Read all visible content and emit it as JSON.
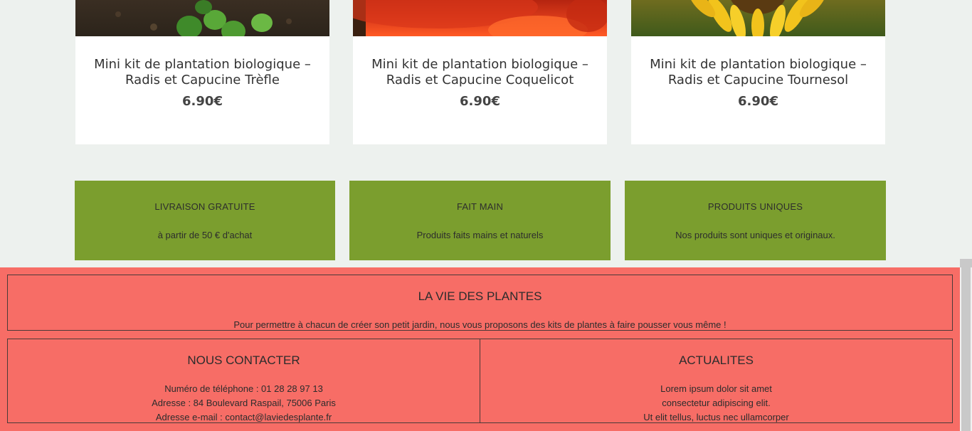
{
  "products": [
    {
      "name": "Mini kit de plantation biologique – Radis et Capucine Trèfle",
      "price": "6.90€",
      "image": "clover-seedling-photo"
    },
    {
      "name": "Mini kit de plantation biologique – Radis et Capucine Coquelicot",
      "price": "6.90€",
      "image": "poppy-flower-photo"
    },
    {
      "name": "Mini kit de plantation biologique – Radis et Capucine Tournesol",
      "price": "6.90€",
      "image": "sunflower-photo"
    }
  ],
  "features": [
    {
      "title": "LIVRAISON GRATUITE",
      "desc": "à partir de 50 € d'achat"
    },
    {
      "title": "FAIT MAIN",
      "desc": "Produits faits mains et naturels"
    },
    {
      "title": "PRODUITS UNIQUES",
      "desc": "Nos produits sont uniques et originaux."
    }
  ],
  "footer": {
    "about": {
      "title": "LA VIE DES PLANTES",
      "text": "Pour permettre à chacun de créer son petit jardin, nous vous proposons des kits de plantes à faire pousser vous même !"
    },
    "contact": {
      "title": "NOUS CONTACTER",
      "phone": "Numéro de téléphone : 01 28 28 97 13",
      "address": "Adresse : 84 Boulevard Raspail, 75006 Paris",
      "email": "Adresse e-mail : contact@laviedesplante.fr"
    },
    "news": {
      "title": "ACTUALITES",
      "line1": "Lorem ipsum dolor sit amet",
      "line2": "consectetur adipiscing elit.",
      "line3": "Ut elit tellus, luctus nec ullamcorper"
    }
  },
  "colors": {
    "background": "#edf1ee",
    "card": "#ffffff",
    "feature_green": "#7b9e2e",
    "footer_red": "#f76d66"
  }
}
